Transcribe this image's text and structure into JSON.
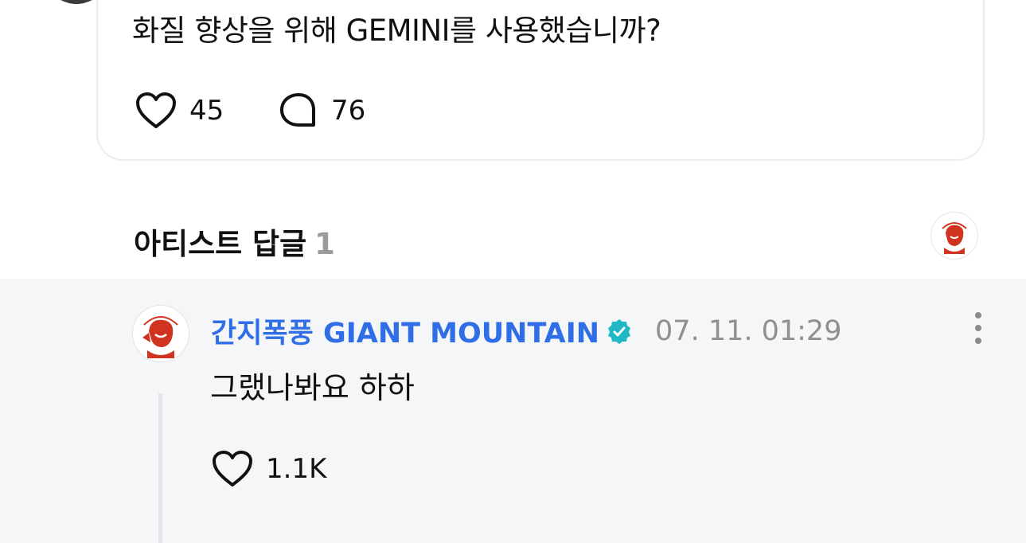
{
  "fan_comment": {
    "text": "화질 향상을 위해 GEMINI를 사용했습니까?",
    "like_count": "45",
    "comment_count": "76"
  },
  "artist_replies": {
    "title": "아티스트 답글",
    "count": "1"
  },
  "reply": {
    "author": "간지폭풍 GIANT MOUNTAIN",
    "timestamp": "07. 11. 01:29",
    "text": "그랬나봐요 하하",
    "like_count": "1.1K"
  },
  "colors": {
    "author_blue": "#2f6ee6",
    "verified_teal": "#1fb8c4",
    "panel_bg": "#f5f6f8"
  },
  "icons": [
    "heart-icon",
    "comment-bubble-icon",
    "verified-badge-icon",
    "more-vertical-icon"
  ]
}
